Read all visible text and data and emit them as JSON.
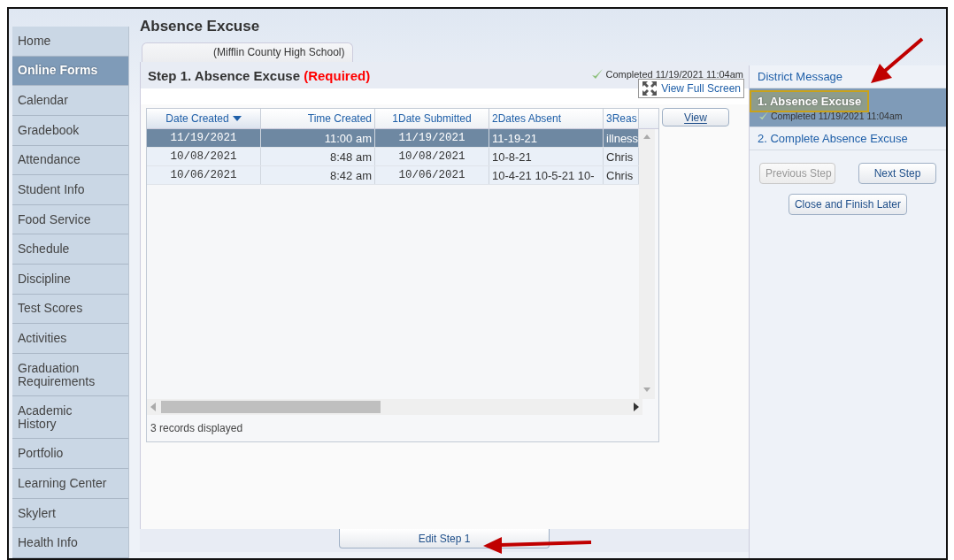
{
  "sidebar": {
    "items": [
      {
        "label": "Home",
        "selected": false
      },
      {
        "label": "Online Forms",
        "selected": true
      },
      {
        "label": "Calendar",
        "selected": false
      },
      {
        "label": "Gradebook",
        "selected": false
      },
      {
        "label": "Attendance",
        "selected": false
      },
      {
        "label": "Student Info",
        "selected": false
      },
      {
        "label": "Food Service",
        "selected": false
      },
      {
        "label": "Schedule",
        "selected": false
      },
      {
        "label": "Discipline",
        "selected": false
      },
      {
        "label": "Test Scores",
        "selected": false
      },
      {
        "label": "Activities",
        "selected": false
      },
      {
        "label": "Graduation Requirements",
        "selected": false
      },
      {
        "label": "Academic History",
        "selected": false
      },
      {
        "label": "Portfolio",
        "selected": false
      },
      {
        "label": "Learning Center",
        "selected": false
      },
      {
        "label": "Skylert",
        "selected": false
      },
      {
        "label": "Health Info",
        "selected": false
      }
    ]
  },
  "page": {
    "title": "Absence Excuse",
    "tab": "(Mifflin County High School)"
  },
  "step": {
    "title": "Step 1. Absence Excuse",
    "required": "(Required)",
    "completed": "Completed 11/19/2021 11:04am",
    "full_screen": "View Full Screen"
  },
  "table": {
    "columns": [
      {
        "label": "Date Created",
        "sorted": true
      },
      {
        "label": "Time Created",
        "sorted": false
      },
      {
        "label": "1Date Submitted",
        "sorted": false
      },
      {
        "label": "2Dates Absent",
        "sorted": false
      },
      {
        "label": "3Reas",
        "sorted": false
      }
    ],
    "rows": [
      {
        "selected": true,
        "cells": [
          "11/19/2021",
          "11:00 am",
          "11/19/2021",
          "11-19-21",
          "illness"
        ]
      },
      {
        "selected": false,
        "cells": [
          "10/08/2021",
          "8:48 am",
          "10/08/2021",
          "10-8-21",
          "Chris"
        ]
      },
      {
        "selected": false,
        "cells": [
          "10/06/2021",
          "8:42 am",
          "10/06/2021",
          "10-4-21 10-5-21 10-",
          "Chris"
        ]
      }
    ],
    "footer": "3 records displayed",
    "view_button": "View"
  },
  "steps": [
    {
      "label": "District Message",
      "selected": false
    },
    {
      "label": "1. Absence Excuse",
      "selected": true,
      "status": "Completed 11/19/2021 11:04am"
    },
    {
      "label": "2. Complete Absence Excuse",
      "selected": false
    }
  ],
  "buttons": [
    {
      "label": "Previous Step",
      "disabled": true
    },
    {
      "label": "Next Step",
      "disabled": false
    },
    {
      "label": "Close and Finish Later",
      "disabled": false
    }
  ],
  "edit_button": "Edit Step 1"
}
